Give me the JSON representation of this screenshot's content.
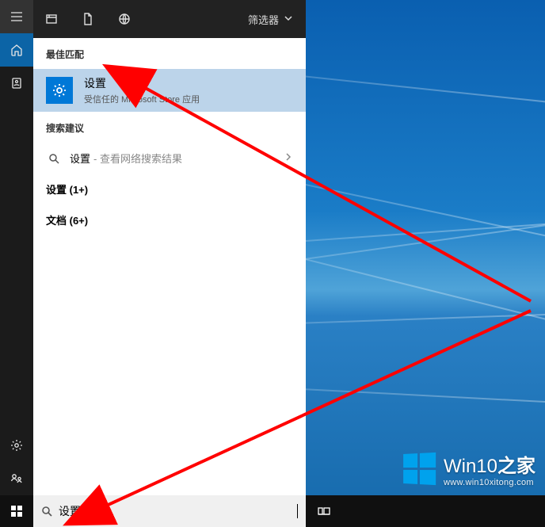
{
  "topbar": {
    "filter_label": "筛选器"
  },
  "sections": {
    "best_match": "最佳匹配",
    "search_suggestions": "搜索建议"
  },
  "best_result": {
    "title": "设置",
    "subtitle": "受信任的 Microsoft Store 应用"
  },
  "web_suggestion": {
    "term": "设置",
    "hint": " - 查看网络搜索结果"
  },
  "extras": {
    "settings": "设置 (1+)",
    "documents": "文档 (6+)"
  },
  "search": {
    "value": "设置",
    "placeholder": ""
  },
  "watermark": {
    "title_a": "Win10",
    "title_b": "之家",
    "url": "www.win10xitong.com"
  }
}
